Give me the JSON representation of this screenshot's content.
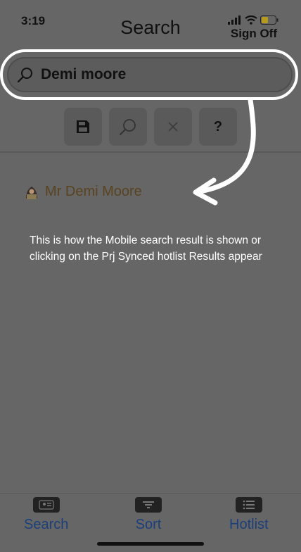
{
  "status": {
    "time": "3:19"
  },
  "header": {
    "title": "Search",
    "sign_off": "Sign Off"
  },
  "search": {
    "value": "Demi moore"
  },
  "toolbar": {
    "help_label": "?"
  },
  "results": [
    {
      "name": "Mr Demi Moore"
    }
  ],
  "caption": "This is how the  Mobile search result is shown or clicking on the Prj Synced hotlist Results appear",
  "tabs": [
    {
      "label": "Search",
      "icon": "id-card-icon"
    },
    {
      "label": "Sort",
      "icon": "sort-icon"
    },
    {
      "label": "Hotlist",
      "icon": "list-icon"
    }
  ],
  "colors": {
    "background": "#666666",
    "tab_label": "#1a3f7a",
    "result_name": "#5a4320",
    "annotation": "#ffffff"
  }
}
